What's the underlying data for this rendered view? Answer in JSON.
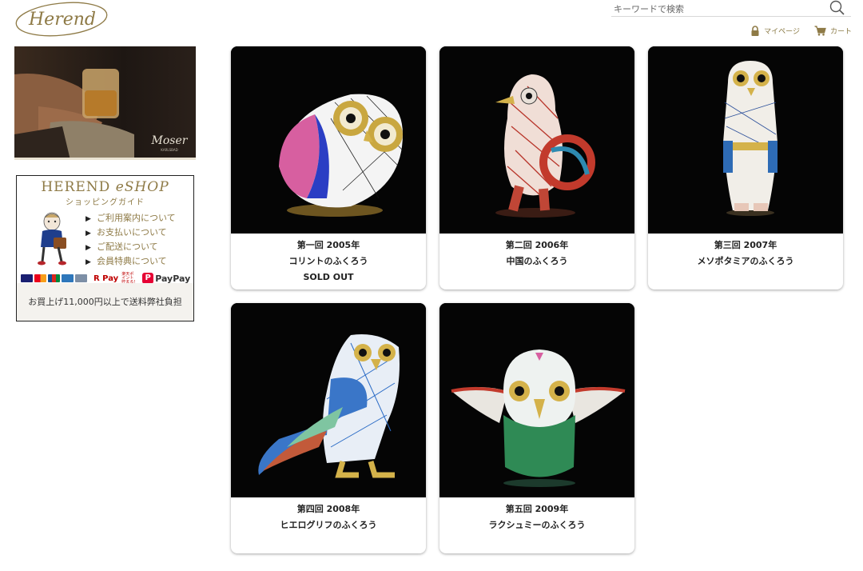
{
  "header": {
    "logo_text": "Herend",
    "search_placeholder": "キーワードで検索",
    "links": [
      {
        "label": "マイページ",
        "icon": "lock-icon"
      },
      {
        "label": "カート",
        "icon": "cart-icon"
      }
    ]
  },
  "sidebar": {
    "banner_brand": "Moser",
    "banner_brand_sub": "KARLSBAD",
    "guide": {
      "title_main": "HEREND ",
      "title_em": "eSHOP",
      "subtitle": "ショッピングガイド",
      "items": [
        {
          "label": "ご利用案内について"
        },
        {
          "label": "お支払いについて"
        },
        {
          "label": "ご配送について"
        },
        {
          "label": "会員特典について"
        }
      ],
      "payment": {
        "rpay": "R Pay",
        "rpay_note": "楽天ポイント貯まる!",
        "paypay": "PayPay",
        "paypay_mark": "P"
      },
      "footer": "お買上げ11,000円以上で送料弊社負担"
    }
  },
  "products": [
    {
      "line1": "第一回 2005年",
      "line2": "コリントのふくろう",
      "line3": "SOLD OUT"
    },
    {
      "line1": "第二回 2006年",
      "line2": "中国のふくろう",
      "line3": ""
    },
    {
      "line1": "第三回 2007年",
      "line2": "メソポタミアのふくろう",
      "line3": ""
    },
    {
      "line1": "第四回 2008年",
      "line2": "ヒエログリフのふくろう",
      "line3": ""
    },
    {
      "line1": "第五回 2009年",
      "line2": "ラクシュミーのふくろう",
      "line3": ""
    }
  ],
  "colors": {
    "accent": "#8e7a46",
    "card_image_bg": "#050505"
  }
}
